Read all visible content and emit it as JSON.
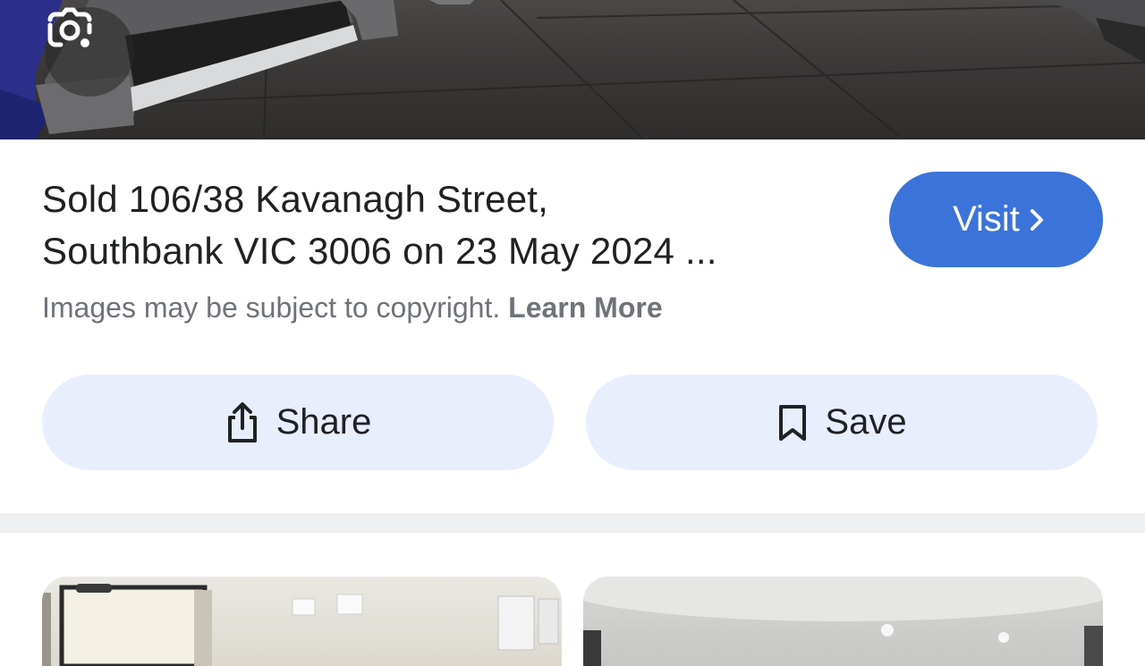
{
  "hero": {
    "lens_icon": "google-lens-camera-icon"
  },
  "result": {
    "title_line1": "Sold 106/38 Kavanagh Street,",
    "title_line2": "Southbank VIC 3006 on 23 May 2024 ...",
    "visit_label": "Visit",
    "copyright_text": "Images may be subject to copyright.",
    "learn_more_label": "Learn More"
  },
  "actions": {
    "share_label": "Share",
    "save_label": "Save"
  },
  "colors": {
    "visit_button": "#3b73d9",
    "action_button_bg": "#e8eefb",
    "secondary_text": "#6f7378"
  }
}
